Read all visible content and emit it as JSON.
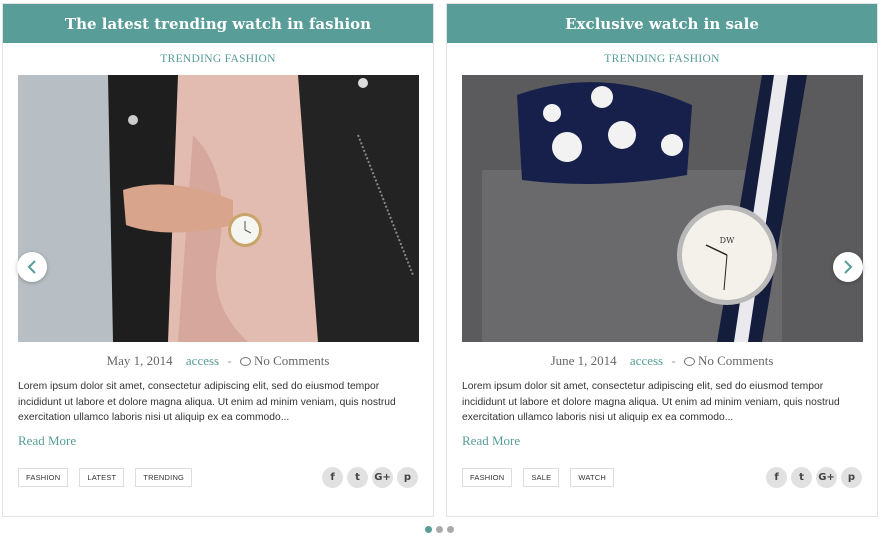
{
  "carousel": {
    "prev_icon": "chevron-left-icon",
    "next_icon": "chevron-right-icon",
    "dot_count": 3,
    "active_dot": 0,
    "accent_color": "#589d97"
  },
  "posts": [
    {
      "title": "The latest trending watch in fashion",
      "category": "TRENDING FASHION",
      "date": "May 1, 2014",
      "author": "access",
      "separator": "-",
      "comments": "No Comments",
      "excerpt": "Lorem ipsum dolor sit amet, consectetur adipiscing elit, sed do eiusmod tempor incididunt ut labore et dolore magna aliqua. Ut enim ad minim veniam, quis nostrud exercitation ullamco laboris nisi ut aliquip ex ea commodo...",
      "read_more": "Read More",
      "tags": [
        "FASHION",
        "LATEST",
        "TRENDING"
      ],
      "share_icons": [
        "facebook-icon",
        "twitter-icon",
        "google-plus-icon",
        "pinterest-icon"
      ]
    },
    {
      "title": "Exclusive watch in sale",
      "category": "TRENDING FASHION",
      "date": "June 1, 2014",
      "author": "access",
      "separator": "-",
      "comments": "No Comments",
      "excerpt": "Lorem ipsum dolor sit amet, consectetur adipiscing elit, sed do eiusmod tempor incididunt ut labore et dolore magna aliqua. Ut enim ad minim veniam, quis nostrud exercitation ullamco laboris nisi ut aliquip ex ea commodo...",
      "read_more": "Read More",
      "tags": [
        "FASHION",
        "SALE",
        "WATCH"
      ],
      "share_icons": [
        "facebook-icon",
        "twitter-icon",
        "google-plus-icon",
        "pinterest-icon"
      ]
    }
  ],
  "share_glyphs": {
    "facebook": "f",
    "twitter": "t",
    "google_plus": "G+",
    "pinterest": "p"
  }
}
